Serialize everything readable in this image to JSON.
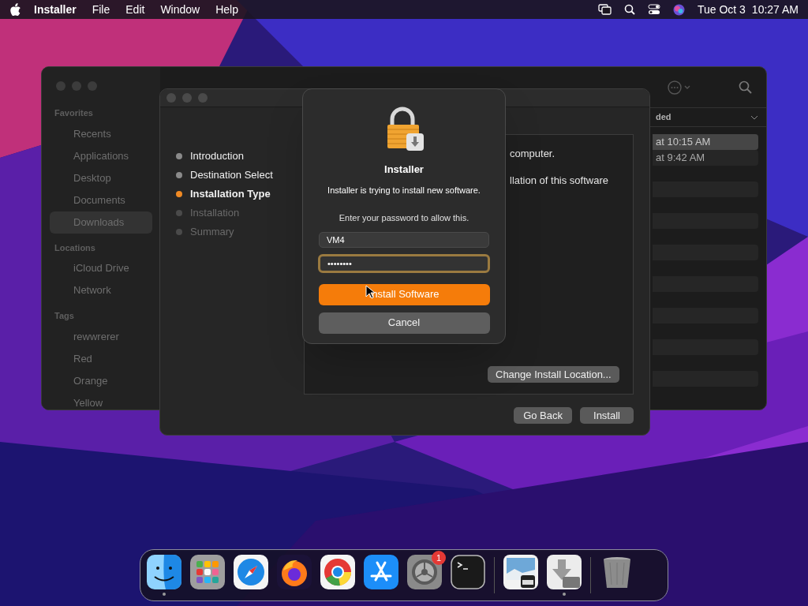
{
  "menu_bar": {
    "app_name": "Installer",
    "menus": [
      "File",
      "Edit",
      "Window",
      "Help"
    ],
    "date": "Tue Oct 3",
    "time": "10:27 AM"
  },
  "finder": {
    "sidebar": [
      {
        "heading": "Favorites",
        "items": [
          {
            "label": "Recents",
            "selected": false
          },
          {
            "label": "Applications",
            "selected": false
          },
          {
            "label": "Desktop",
            "selected": false
          },
          {
            "label": "Documents",
            "selected": false
          },
          {
            "label": "Downloads",
            "selected": true
          }
        ]
      },
      {
        "heading": "Locations",
        "items": [
          {
            "label": "iCloud Drive",
            "selected": false
          },
          {
            "label": "Network",
            "selected": false
          }
        ]
      },
      {
        "heading": "Tags",
        "items": [
          {
            "label": "rewwrerer",
            "selected": false
          },
          {
            "label": "Red",
            "selected": false
          },
          {
            "label": "Orange",
            "selected": false
          },
          {
            "label": "Yellow",
            "selected": false
          }
        ]
      }
    ],
    "column_header": "ded",
    "rows": [
      {
        "text": "at 10:15 AM",
        "selected": true
      },
      {
        "text": "at 9:42 AM",
        "selected": false
      }
    ]
  },
  "installer": {
    "steps": [
      {
        "label": "Introduction",
        "selected": false,
        "enabled": true
      },
      {
        "label": "Destination Select",
        "selected": false,
        "enabled": true
      },
      {
        "label": "Installation Type",
        "selected": true,
        "enabled": true
      },
      {
        "label": "Installation",
        "selected": false,
        "enabled": false
      },
      {
        "label": "Summary",
        "selected": false,
        "enabled": false
      }
    ],
    "body_lines": [
      "computer.",
      "llation of this software"
    ],
    "change_location": "Change Install Location...",
    "buttons": [
      "Go Back",
      "Install"
    ]
  },
  "dialog": {
    "title": "Installer",
    "message": "Installer is trying to install new software.",
    "prompt": "Enter your password to allow this.",
    "username": "VM4",
    "password": "••••••••",
    "password_focused": true,
    "buttons": [
      {
        "label": "Install Software",
        "default": true
      },
      {
        "label": "Cancel",
        "default": false
      }
    ]
  },
  "dock": {
    "items": [
      {
        "kind": "finder",
        "running": true
      },
      {
        "kind": "launchpad",
        "running": false
      },
      {
        "kind": "safari",
        "running": false
      },
      {
        "kind": "firefox",
        "running": false
      },
      {
        "kind": "chrome",
        "running": false
      },
      {
        "kind": "appstore",
        "running": false
      },
      {
        "kind": "settings",
        "running": false,
        "badge": "1"
      },
      {
        "kind": "terminal",
        "running": false
      },
      {
        "kind": "divider"
      },
      {
        "kind": "preview",
        "running": false
      },
      {
        "kind": "installer",
        "running": true
      },
      {
        "kind": "divider"
      },
      {
        "kind": "trash",
        "running": false
      }
    ]
  }
}
